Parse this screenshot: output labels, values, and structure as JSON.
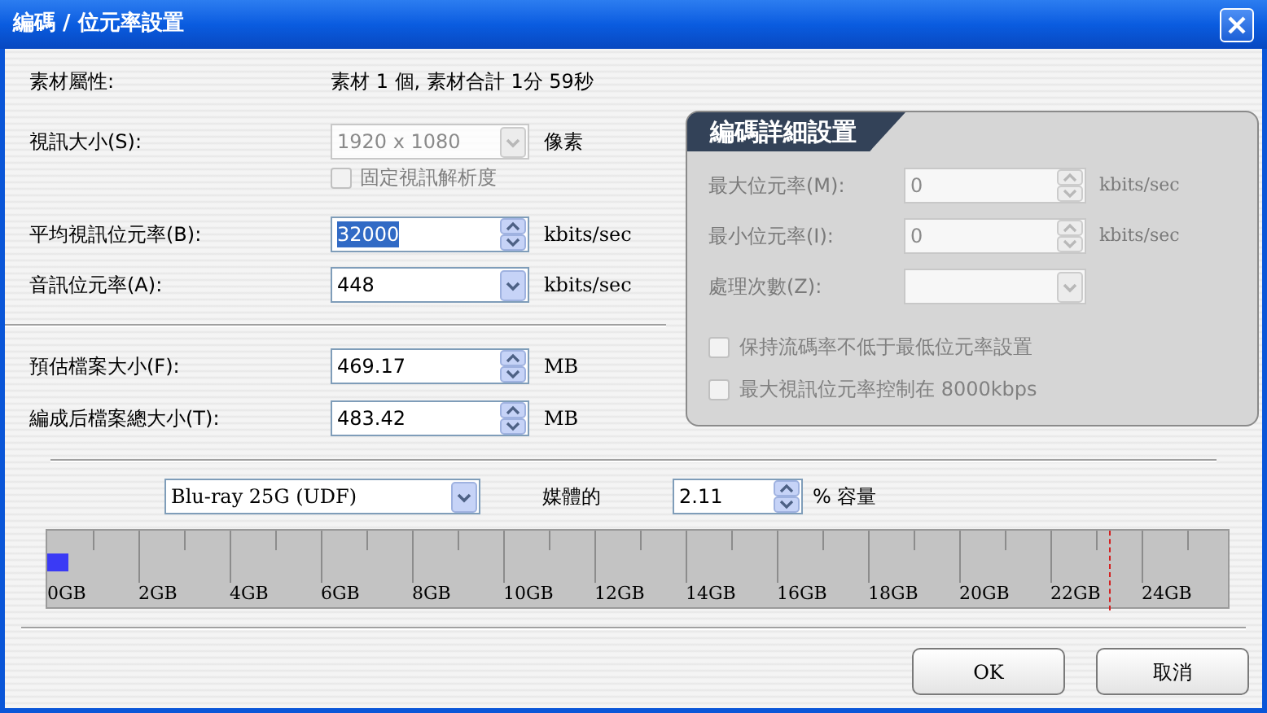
{
  "window": {
    "title": "編碼 / 位元率設置"
  },
  "source": {
    "label": "素材屬性:",
    "value": "素材 1 個, 素材合計 1分 59秒"
  },
  "video_size": {
    "label": "視訊大小(S):",
    "value": "1920 x 1080",
    "unit": "像素",
    "disabled": true
  },
  "fixed_resolution": {
    "label": "固定視訊解析度",
    "checked": false,
    "disabled": true
  },
  "bitrate_fields": [
    {
      "label": "平均視訊位元率(B):",
      "value": "32000",
      "kind": "spin",
      "unit": "kbits/sec",
      "selected": true
    },
    {
      "label": "音訊位元率(A):",
      "value": "448",
      "kind": "dropdown",
      "unit": "kbits/sec",
      "selected": false
    }
  ],
  "size_fields": [
    {
      "label": "預估檔案大小(F):",
      "value": "469.17",
      "kind": "spin",
      "unit": "MB",
      "selected": false
    },
    {
      "label": "編成后檔案總大小(T):",
      "value": "483.42",
      "kind": "spin",
      "unit": "MB",
      "selected": false
    }
  ],
  "detail_panel": {
    "title": "編碼詳細設置",
    "fields": [
      {
        "label": "最大位元率(M):",
        "value": "0",
        "kind": "spin",
        "unit": "kbits/sec",
        "disabled": true
      },
      {
        "label": "最小位元率(I):",
        "value": "0",
        "kind": "spin",
        "unit": "kbits/sec",
        "disabled": true
      },
      {
        "label": "處理次數(Z):",
        "kind": "dropdown",
        "disabled": true
      }
    ],
    "checkboxes": [
      {
        "label": "保持流碼率不低于最低位元率設置",
        "checked": false,
        "disabled": true
      },
      {
        "label": "最大視訊位元率控制在 8000kbps",
        "checked": false,
        "disabled": true
      }
    ]
  },
  "media": {
    "disc": "Blu-ray 25G (UDF)",
    "label": "媒體的",
    "percent": "2.11",
    "unit": "% 容量"
  },
  "capacity_scale": [
    "0GB",
    "2GB",
    "4GB",
    "6GB",
    "8GB",
    "10GB",
    "12GB",
    "14GB",
    "16GB",
    "18GB",
    "20GB",
    "22GB",
    "24GB"
  ],
  "buttons": [
    "OK",
    "取消"
  ]
}
